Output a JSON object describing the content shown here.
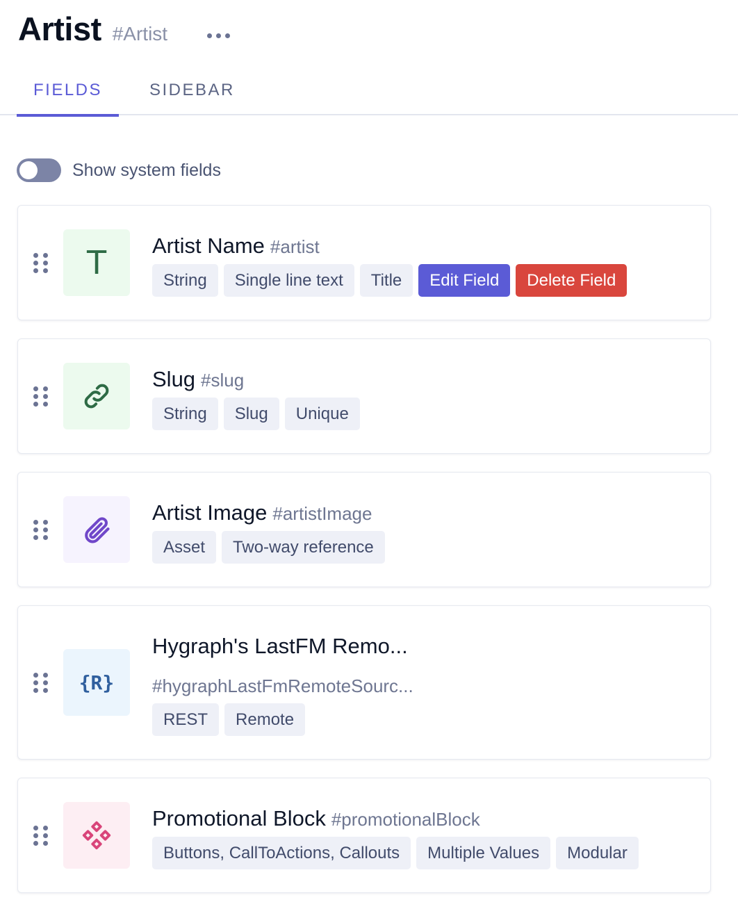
{
  "header": {
    "title": "Artist",
    "api_id": "#Artist"
  },
  "tabs": [
    {
      "label": "FIELDS",
      "active": true
    },
    {
      "label": "SIDEBAR",
      "active": false
    }
  ],
  "system_fields_toggle": {
    "label": "Show system fields",
    "on": false
  },
  "fields": [
    {
      "name": "Artist Name",
      "api_id": "#artist",
      "icon": "text-type-icon",
      "icon_glyph": "T",
      "tags": [
        "String",
        "Single line text",
        "Title"
      ],
      "actions": {
        "edit": "Edit Field",
        "delete": "Delete Field"
      }
    },
    {
      "name": "Slug",
      "api_id": "#slug",
      "icon": "link-icon",
      "tags": [
        "String",
        "Slug",
        "Unique"
      ]
    },
    {
      "name": "Artist Image",
      "api_id": "#artistImage",
      "icon": "paperclip-icon",
      "tags": [
        "Asset",
        "Two-way reference"
      ]
    },
    {
      "name": "Hygraph's LastFM Remo...",
      "api_id": "#hygraphLastFmRemoteSourc...",
      "icon": "rest-remote-icon",
      "icon_glyph": "{R}",
      "tags": [
        "REST",
        "Remote"
      ]
    },
    {
      "name": "Promotional Block",
      "api_id": "#promotionalBlock",
      "icon": "modular-component-icon",
      "tags": [
        "Buttons, CallToActions, Callouts",
        "Multiple Values",
        "Modular"
      ]
    }
  ],
  "colors": {
    "accent": "#5b5bd6",
    "danger": "#d9463d",
    "tag_bg": "#eef0f7",
    "green_icon_bg": "#ecfaee",
    "purple_icon_bg": "#f6f3fe",
    "blue_icon_bg": "#ebf5fd",
    "pink_icon_bg": "#fdeef3"
  }
}
